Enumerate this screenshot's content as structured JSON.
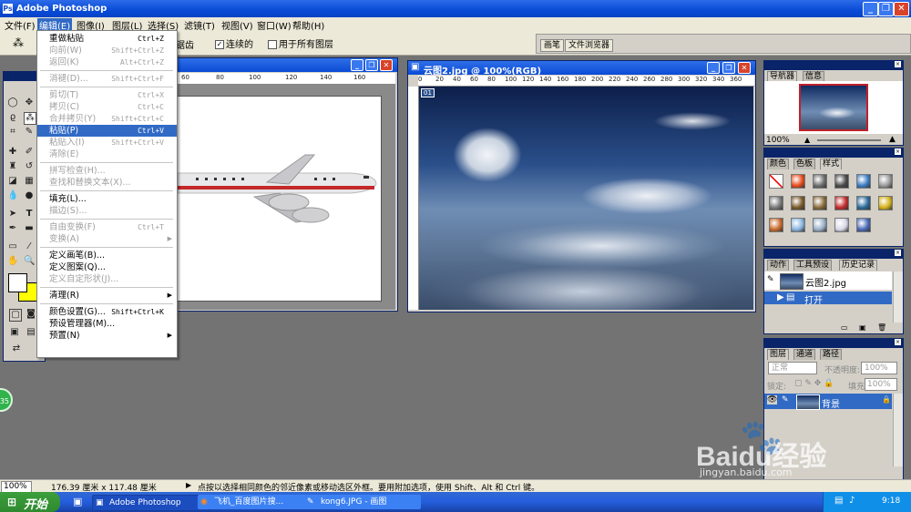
{
  "window": {
    "title": "Adobe Photoshop"
  },
  "menubar": [
    "文件(F)",
    "编辑(E)",
    "图像(I)",
    "图层(L)",
    "选择(S)",
    "滤镜(T)",
    "视图(V)",
    "窗口(W)",
    "帮助(H)"
  ],
  "options_bar": {
    "partial_label": "锯齿",
    "contiguous": "连续的",
    "all_layers": "用于所有图层"
  },
  "palette_well_tabs": [
    "画笔",
    "文件浏览器"
  ],
  "doc_left": {
    "ruler_marks": [
      "60",
      "80",
      "100",
      "120",
      "140",
      "160"
    ]
  },
  "doc_right": {
    "title": "云图2.jpg @ 100%(RGB)",
    "ruler_marks": [
      "0",
      "20",
      "40",
      "60",
      "80",
      "100",
      "120",
      "140",
      "160",
      "180",
      "200",
      "220",
      "240",
      "260",
      "280",
      "300",
      "320",
      "340",
      "360"
    ]
  },
  "edit_menu": {
    "items": [
      {
        "label": "重做粘贴",
        "shortcut": "Ctrl+Z",
        "disabled": false
      },
      {
        "label": "向前(W)",
        "shortcut": "Shift+Ctrl+Z",
        "disabled": true
      },
      {
        "label": "返回(K)",
        "shortcut": "Alt+Ctrl+Z",
        "disabled": true
      },
      {
        "sep": true
      },
      {
        "label": "消褪(D)...",
        "shortcut": "Shift+Ctrl+F",
        "disabled": true
      },
      {
        "sep": true
      },
      {
        "label": "剪切(T)",
        "shortcut": "Ctrl+X",
        "disabled": true
      },
      {
        "label": "拷贝(C)",
        "shortcut": "Ctrl+C",
        "disabled": true
      },
      {
        "label": "合并拷贝(Y)",
        "shortcut": "Shift+Ctrl+C",
        "disabled": true
      },
      {
        "label": "粘贴(P)",
        "shortcut": "Ctrl+V",
        "disabled": false,
        "highlight": true
      },
      {
        "label": "粘贴入(I)",
        "shortcut": "Shift+Ctrl+V",
        "disabled": true
      },
      {
        "label": "清除(E)",
        "shortcut": "",
        "disabled": true
      },
      {
        "sep": true
      },
      {
        "label": "拼写检查(H)...",
        "shortcut": "",
        "disabled": true
      },
      {
        "label": "查找和替换文本(X)...",
        "shortcut": "",
        "disabled": true
      },
      {
        "sep": true
      },
      {
        "label": "填充(L)...",
        "shortcut": "",
        "disabled": false
      },
      {
        "label": "描边(S)...",
        "shortcut": "",
        "disabled": true
      },
      {
        "sep": true
      },
      {
        "label": "自由变换(F)",
        "shortcut": "Ctrl+T",
        "disabled": true
      },
      {
        "label": "变换(A)",
        "shortcut": "",
        "disabled": true,
        "submenu": true
      },
      {
        "sep": true
      },
      {
        "label": "定义画笔(B)...",
        "shortcut": "",
        "disabled": false
      },
      {
        "label": "定义图案(Q)...",
        "shortcut": "",
        "disabled": false
      },
      {
        "label": "定义自定形状(J)...",
        "shortcut": "",
        "disabled": true
      },
      {
        "sep": true
      },
      {
        "label": "清理(R)",
        "shortcut": "",
        "disabled": false,
        "submenu": true
      },
      {
        "sep": true
      },
      {
        "label": "颜色设置(G)...",
        "shortcut": "Shift+Ctrl+K",
        "disabled": false
      },
      {
        "label": "预设管理器(M)...",
        "shortcut": "",
        "disabled": false
      },
      {
        "label": "预置(N)",
        "shortcut": "",
        "disabled": false,
        "submenu": true
      }
    ]
  },
  "navigator": {
    "tabs": [
      "导航器",
      "信息"
    ],
    "zoom": "100%"
  },
  "styles": {
    "tabs": [
      "颜色",
      "色板",
      "样式"
    ],
    "swatch_colors": [
      "#ffffff",
      "#e84c1e",
      "#6e6e6e",
      "#4a4a4a",
      "#3a7cc2",
      "#9a9a9a",
      "#7a7a7a",
      "#7a5a2a",
      "#8a6a3a",
      "#c22a2a",
      "#2a6a9a",
      "#d4b21a",
      "#c86a2a",
      "#8ab6e0",
      "#9ab0c8",
      "#d8d8e8",
      "#4a6ab8",
      ""
    ]
  },
  "history": {
    "tabs": [
      "动作",
      "工具预设",
      "历史记录"
    ],
    "snapshot": "云图2.jpg",
    "step": "打开"
  },
  "layers": {
    "tabs": [
      "图层",
      "通道",
      "路径"
    ],
    "blend_mode": "正常",
    "opacity_label": "不透明度:",
    "opacity": "100%",
    "lock_label": "锁定:",
    "fill_label": "填充:",
    "fill": "100%",
    "layer_name": "背景"
  },
  "statusbar": {
    "zoom": "100%",
    "doc_size": "176.39 厘米 x 117.48 厘米",
    "hint": "点按以选择相同颜色的邻近像素或移动选区外框。要用附加选项，使用 Shift、Alt 和 Ctrl 键。"
  },
  "taskbar": {
    "start": "开始",
    "tasks": [
      "Adobe Photoshop",
      "飞机_百度图片搜...",
      "kong6.JPG - 画图"
    ],
    "time": "9:18"
  },
  "watermark": {
    "brand": "Baidu经验",
    "url": "jingyan.baidu.com"
  },
  "badge": "35"
}
